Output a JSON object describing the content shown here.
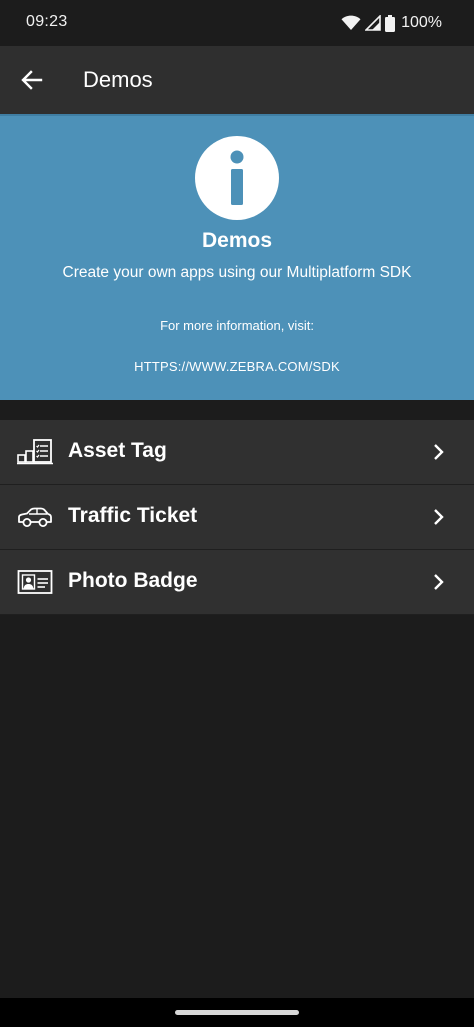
{
  "status_bar": {
    "time": "09:23",
    "battery": "100%",
    "icons": [
      "wifi-icon",
      "signal-icon",
      "battery-icon"
    ]
  },
  "app_bar": {
    "title": "Demos",
    "back_icon": "arrow-left-icon"
  },
  "hero": {
    "icon": "info-icon",
    "title": "Demos",
    "subtitle": "Create your own apps using our Multiplatform SDK",
    "info": "For more information, visit:",
    "link": "HTTPS://WWW.ZEBRA.COM/SDK",
    "color": "#4d91b8"
  },
  "demos": [
    {
      "label": "Asset Tag",
      "icon": "asset-tag-icon"
    },
    {
      "label": "Traffic Ticket",
      "icon": "car-icon"
    },
    {
      "label": "Photo Badge",
      "icon": "id-badge-icon"
    }
  ],
  "colors": {
    "background": "#1c1c1c",
    "app_bar": "#2f2f2f",
    "list_item": "#303030"
  }
}
